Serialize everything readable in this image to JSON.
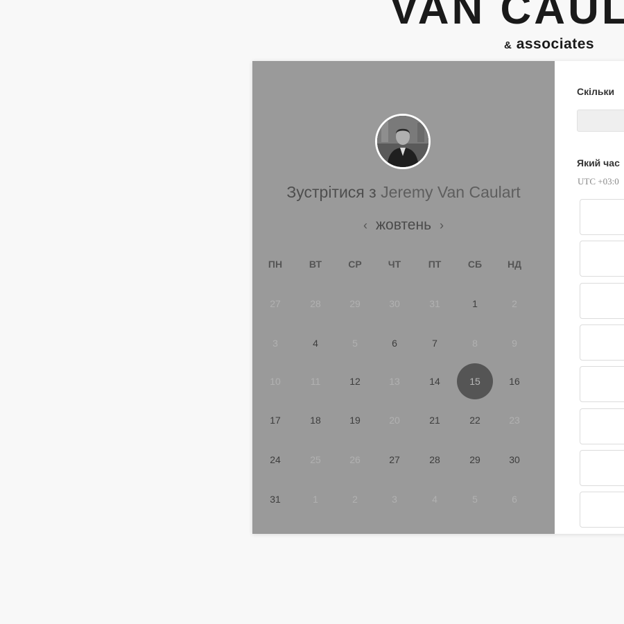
{
  "brand": {
    "logo_main": "VAN CAUL",
    "logo_amp": "&",
    "logo_sub": "associates"
  },
  "booking": {
    "title_prefix": "Зустрітися з",
    "host_name": "Jeremy Van Caulart",
    "month": "жовтень",
    "prev_icon": "chevron-left-icon",
    "next_icon": "chevron-right-icon",
    "weekdays": [
      "ПН",
      "ВТ",
      "СР",
      "ЧТ",
      "ПТ",
      "СБ",
      "НД"
    ],
    "weeks": [
      [
        {
          "d": "27",
          "s": "muted"
        },
        {
          "d": "28",
          "s": "muted"
        },
        {
          "d": "29",
          "s": "muted"
        },
        {
          "d": "30",
          "s": "muted"
        },
        {
          "d": "31",
          "s": "muted"
        },
        {
          "d": "1",
          "s": "avail"
        },
        {
          "d": "2",
          "s": "muted"
        }
      ],
      [
        {
          "d": "3",
          "s": "muted"
        },
        {
          "d": "4",
          "s": "avail"
        },
        {
          "d": "5",
          "s": "muted"
        },
        {
          "d": "6",
          "s": "avail"
        },
        {
          "d": "7",
          "s": "avail"
        },
        {
          "d": "8",
          "s": "muted"
        },
        {
          "d": "9",
          "s": "muted"
        }
      ],
      [
        {
          "d": "10",
          "s": "muted"
        },
        {
          "d": "11",
          "s": "muted"
        },
        {
          "d": "12",
          "s": "avail"
        },
        {
          "d": "13",
          "s": "muted"
        },
        {
          "d": "14",
          "s": "avail"
        },
        {
          "d": "15",
          "s": "selected"
        },
        {
          "d": "16",
          "s": "avail"
        }
      ],
      [
        {
          "d": "17",
          "s": "avail"
        },
        {
          "d": "18",
          "s": "avail"
        },
        {
          "d": "19",
          "s": "avail"
        },
        {
          "d": "20",
          "s": "muted"
        },
        {
          "d": "21",
          "s": "avail"
        },
        {
          "d": "22",
          "s": "avail"
        },
        {
          "d": "23",
          "s": "muted"
        }
      ],
      [
        {
          "d": "24",
          "s": "avail"
        },
        {
          "d": "25",
          "s": "muted"
        },
        {
          "d": "26",
          "s": "muted"
        },
        {
          "d": "27",
          "s": "avail"
        },
        {
          "d": "28",
          "s": "avail"
        },
        {
          "d": "29",
          "s": "avail"
        },
        {
          "d": "30",
          "s": "avail"
        }
      ],
      [
        {
          "d": "31",
          "s": "avail"
        },
        {
          "d": "1",
          "s": "muted"
        },
        {
          "d": "2",
          "s": "muted"
        },
        {
          "d": "3",
          "s": "muted"
        },
        {
          "d": "4",
          "s": "muted"
        },
        {
          "d": "5",
          "s": "muted"
        },
        {
          "d": "6",
          "s": "muted"
        }
      ]
    ],
    "selected_day": "15"
  },
  "details": {
    "duration_label": "Скільки",
    "duration_value": "",
    "time_label": "Який час",
    "timezone": "UTC +03:0",
    "slot_count": 8
  },
  "colors": {
    "overlay_gray": "#9a9a9a",
    "selected_circle": "#555555",
    "page_bg": "#f8f8f8"
  }
}
